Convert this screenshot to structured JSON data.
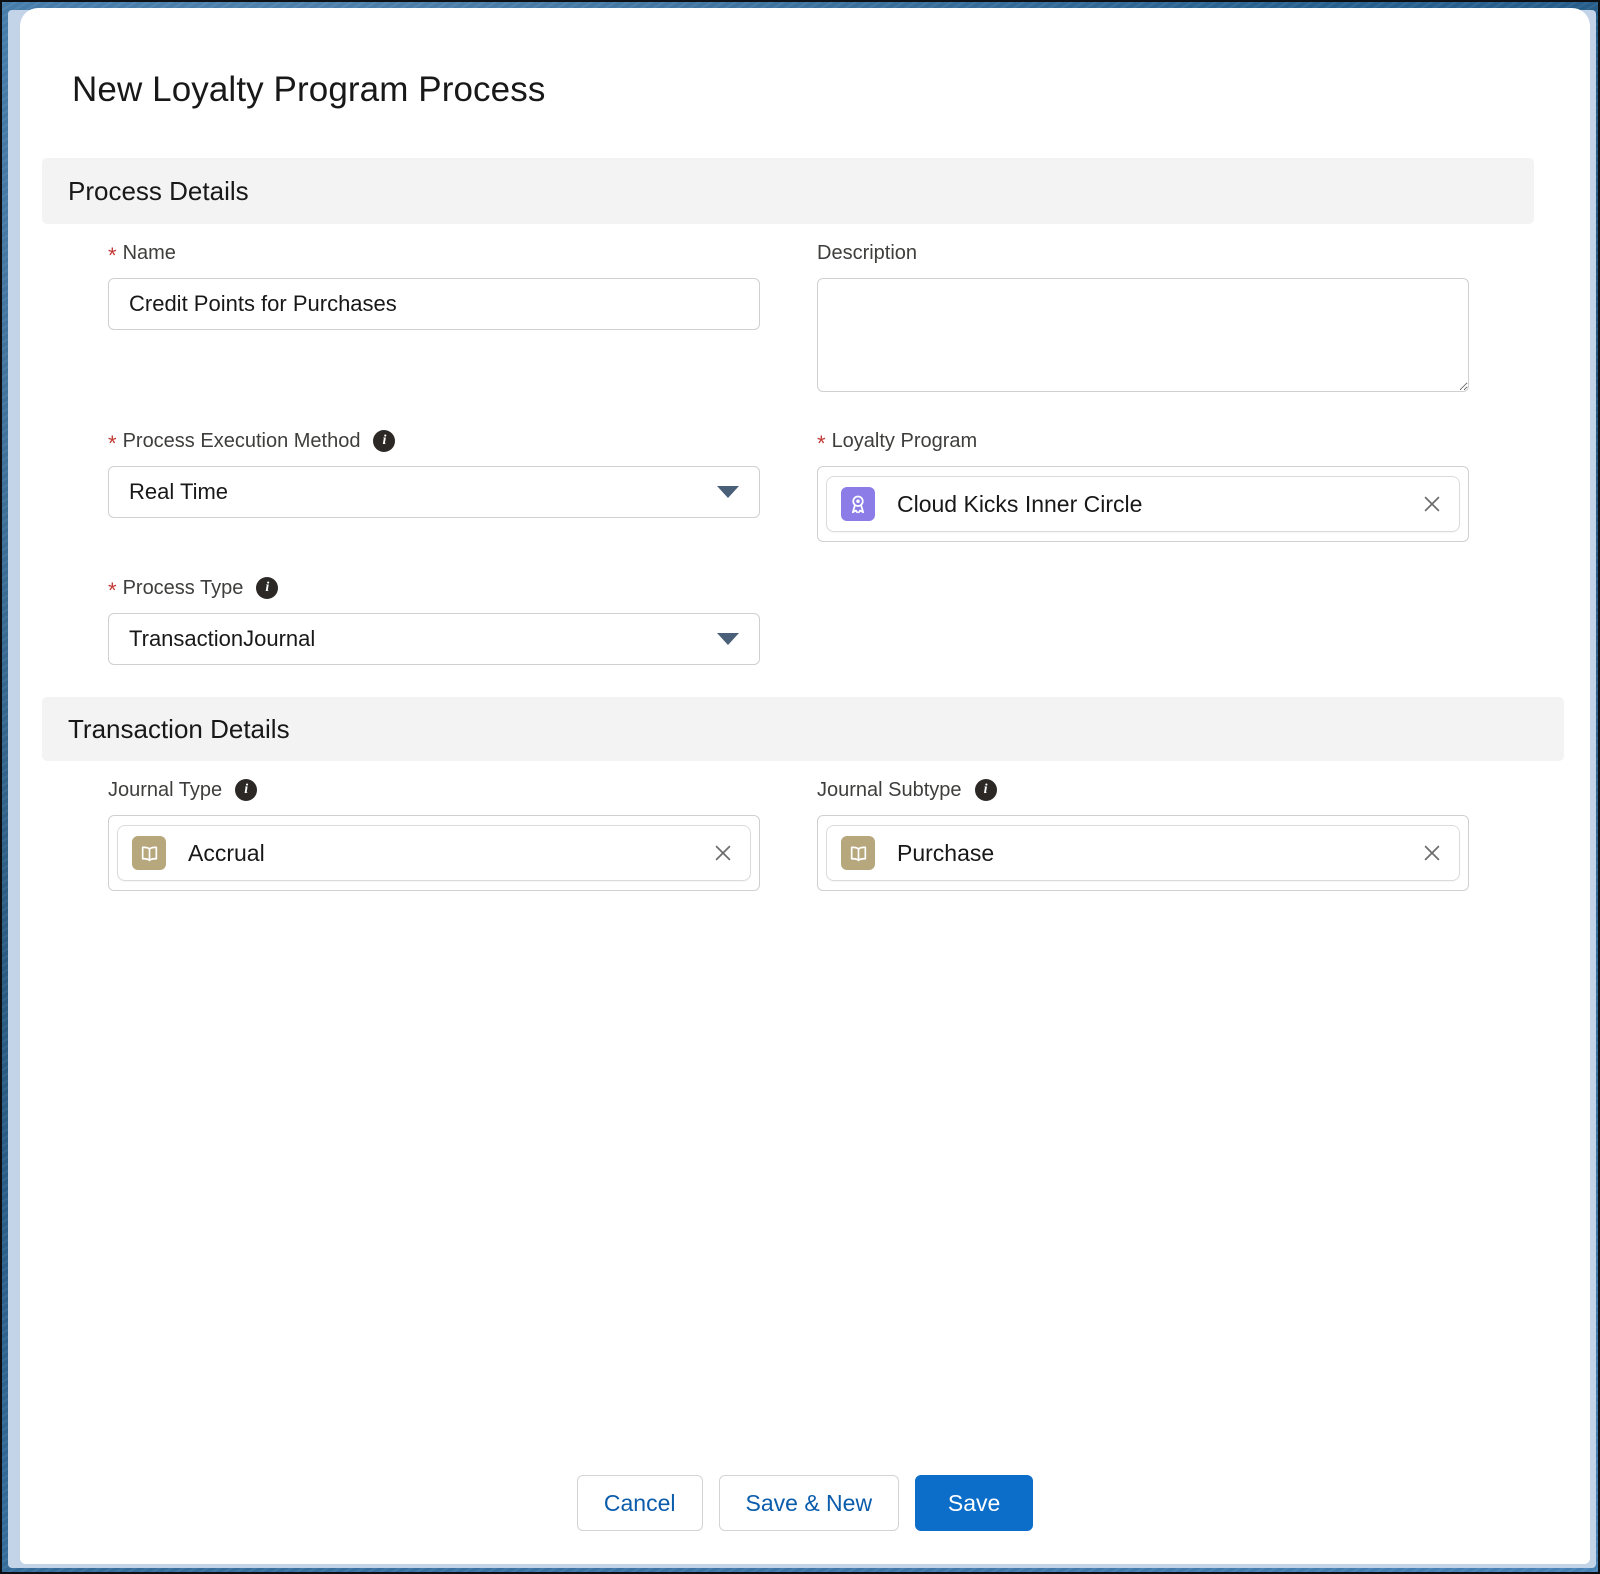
{
  "page": {
    "title": "New Loyalty Program Process"
  },
  "sections": {
    "process_details": {
      "title": "Process Details"
    },
    "transaction_details": {
      "title": "Transaction Details"
    }
  },
  "fields": {
    "name": {
      "label": "Name",
      "required": true,
      "value": "Credit Points for Purchases",
      "placeholder": ""
    },
    "description": {
      "label": "Description",
      "required": false,
      "value": "",
      "placeholder": ""
    },
    "process_execution_method": {
      "label": "Process Execution Method",
      "required": true,
      "value": "Real Time",
      "has_info": true,
      "options": [
        "Real Time"
      ]
    },
    "loyalty_program": {
      "label": "Loyalty Program",
      "required": true,
      "value": "Cloud Kicks Inner Circle",
      "icon": "loyalty-program-badge-icon",
      "icon_color": "#8b7ce8",
      "clear_label": "Clear selection"
    },
    "process_type": {
      "label": "Process Type",
      "required": true,
      "value": "TransactionJournal",
      "has_info": true,
      "options": [
        "TransactionJournal"
      ]
    },
    "journal_type": {
      "label": "Journal Type",
      "required": false,
      "value": "Accrual",
      "has_info": true,
      "icon": "journal-book-icon",
      "icon_color": "#b7a77d",
      "clear_label": "Clear selection"
    },
    "journal_subtype": {
      "label": "Journal Subtype",
      "required": false,
      "value": "Purchase",
      "has_info": true,
      "icon": "journal-book-icon",
      "icon_color": "#b7a77d",
      "clear_label": "Clear selection"
    }
  },
  "footer": {
    "cancel_label": "Cancel",
    "save_new_label": "Save & New",
    "save_label": "Save"
  },
  "colors": {
    "brand_blue": "#0d6ec9",
    "link_blue": "#0b5cab",
    "required_red": "#c23934",
    "section_bg": "#f3f3f3",
    "loyalty_icon": "#8b7ce8",
    "journal_icon": "#b7a77d"
  }
}
